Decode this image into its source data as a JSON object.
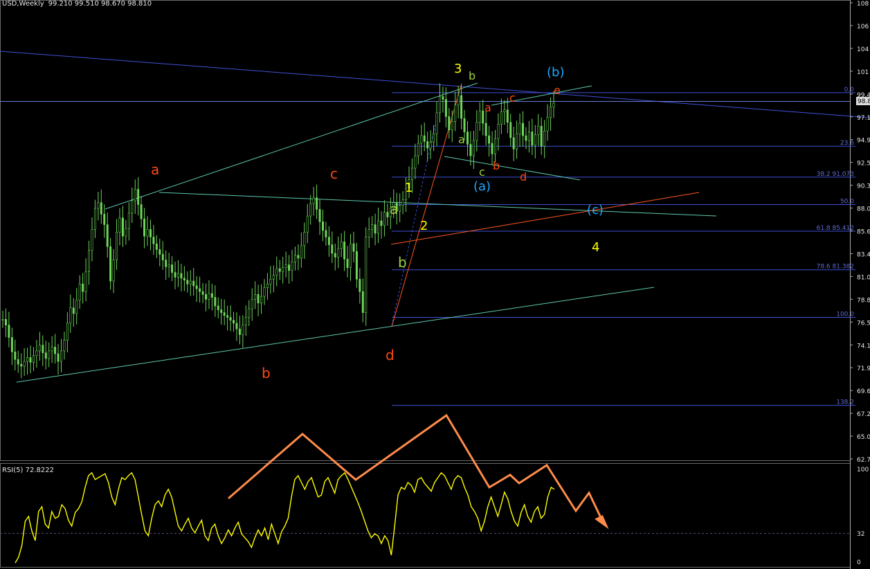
{
  "header": {
    "symbol_text": "USD,Weekly",
    "ohlc_text": "99.210 99.510 98.670 98.810"
  },
  "rsi_header": "RSI(5) 72.8222",
  "colors": {
    "background": "#000000",
    "candles": "#6fd65a",
    "trend_blue": "#3f51d8",
    "trend_cyan": "#5fc9b0",
    "trend_orange": "#ff5a1f",
    "fib": "#3f51d8",
    "rsi": "#ffff00",
    "path_arrows": "#ff8c4a",
    "current_price_line": "#6b7fd9"
  },
  "chart_data": [
    {
      "type": "candlestick",
      "title": "USD,Weekly",
      "ohlc": {
        "open": 99.21,
        "high": 99.51,
        "low": 98.67,
        "close": 98.81
      },
      "y_ticks": [
        "108",
        "106",
        "104",
        "101",
        "99.4",
        "97.1",
        "94.9",
        "92.5",
        "90.3",
        "88.0",
        "85.6",
        "83.4",
        "81.0",
        "78.8",
        "76.5",
        "74.1",
        "71.9",
        "69.6",
        "67.2",
        "65.0",
        "62.7"
      ],
      "ylim": [
        61.6,
        109.3
      ],
      "current_price": "98.8",
      "grid": false,
      "fib_levels": [
        {
          "label": "0.0",
          "price": 99.9
        },
        {
          "label": "23.6",
          "price": 94.3
        },
        {
          "label": "38.2 91.073",
          "price": 91.07
        },
        {
          "label": "50.0",
          "price": 88.2
        },
        {
          "label": "61.8 85.412",
          "price": 85.41
        },
        {
          "label": "78.6 81.382",
          "price": 81.38
        },
        {
          "label": "100.0",
          "price": 76.4
        },
        {
          "label": "138.2",
          "price": 67.2
        }
      ],
      "closes": [
        76.2,
        75.6,
        74.3,
        72.8,
        72.0,
        71.5,
        71.3,
        71.8,
        72.2,
        71.7,
        72.4,
        72.9,
        73.5,
        72.7,
        72.1,
        72.9,
        73.3,
        72.6,
        71.8,
        72.9,
        74.0,
        75.8,
        77.4,
        76.8,
        78.2,
        79.9,
        79.1,
        81.2,
        83.4,
        85.6,
        87.8,
        88.4,
        87.2,
        86.1,
        83.8,
        80.2,
        82.4,
        85.3,
        86.8,
        84.9,
        85.7,
        87.3,
        88.6,
        89.8,
        88.2,
        86.7,
        84.9,
        85.6,
        84.8,
        84.1,
        83.5,
        83.0,
        82.4,
        81.7,
        81.9,
        81.1,
        80.6,
        81.0,
        80.5,
        80.3,
        79.9,
        80.2,
        79.7,
        79.4,
        79.1,
        78.8,
        78.3,
        78.9,
        78.5,
        77.6,
        77.2,
        76.9,
        76.6,
        76.4,
        76.1,
        75.8,
        75.2,
        74.6,
        75.6,
        76.4,
        77.3,
        78.3,
        78.8,
        77.9,
        78.6,
        79.5,
        79.9,
        80.4,
        80.8,
        81.5,
        81.2,
        81.6,
        81.9,
        81.3,
        82.2,
        82.9,
        82.6,
        83.9,
        85.3,
        87.0,
        88.3,
        88.9,
        87.7,
        86.4,
        85.5,
        84.8,
        84.0,
        83.1,
        82.7,
        83.6,
        84.3,
        82.5,
        81.6,
        84.1,
        83.3,
        80.4,
        79.1,
        76.9,
        84.8,
        85.6,
        86.1,
        85.2,
        86.5,
        86.0,
        87.4,
        86.9,
        87.8,
        88.4,
        87.5,
        88.1,
        88.7,
        89.9,
        90.8,
        92.0,
        93.3,
        94.6,
        95.4,
        94.8,
        94.1,
        94.7,
        95.6,
        97.8,
        99.5,
        99.2,
        97.4,
        96.0,
        96.9,
        98.6,
        99.6,
        97.2,
        95.8,
        94.5,
        93.3,
        94.9,
        96.8,
        98.0,
        96.7,
        95.4,
        94.6,
        93.5,
        95.1,
        96.6,
        97.9,
        98.1,
        96.8,
        95.2,
        94.0,
        95.6,
        96.7,
        95.4,
        94.9,
        95.8,
        94.4,
        95.5,
        96.4,
        94.3,
        95.9,
        97.3,
        98.4,
        98.8
      ],
      "wave_labels": [
        "a",
        "b",
        "c",
        "d",
        "a",
        "b",
        "1",
        "2",
        "3",
        "a",
        "b",
        "c",
        "(a)",
        "a",
        "b",
        "c",
        "d",
        "e",
        "(b)",
        "(c)",
        "4"
      ]
    },
    {
      "type": "line",
      "title": "RSI(5) 72.8222",
      "y_ticks": [
        "100",
        "32",
        "0"
      ],
      "ylim": [
        0,
        100
      ],
      "level": 32,
      "values": [
        2,
        8,
        20,
        45,
        50,
        35,
        25,
        55,
        60,
        42,
        38,
        55,
        48,
        50,
        62,
        58,
        46,
        40,
        54,
        58,
        65,
        80,
        92,
        95,
        88,
        90,
        92,
        94,
        85,
        70,
        62,
        78,
        90,
        88,
        92,
        95,
        88,
        70,
        52,
        35,
        30,
        48,
        62,
        66,
        60,
        72,
        78,
        70,
        55,
        40,
        35,
        42,
        48,
        38,
        33,
        40,
        46,
        30,
        25,
        38,
        42,
        30,
        22,
        28,
        36,
        30,
        38,
        44,
        32,
        28,
        24,
        18,
        28,
        36,
        30,
        38,
        26,
        42,
        32,
        22,
        34,
        40,
        48,
        70,
        88,
        92,
        85,
        78,
        86,
        90,
        80,
        70,
        72,
        86,
        90,
        82,
        74,
        88,
        92,
        95,
        88,
        80,
        72,
        64,
        55,
        45,
        35,
        28,
        32,
        30,
        22,
        30,
        25,
        10,
        40,
        72,
        80,
        78,
        85,
        82,
        75,
        88,
        90,
        84,
        80,
        76,
        85,
        90,
        95,
        92,
        85,
        78,
        88,
        92,
        90,
        80,
        72,
        60,
        55,
        48,
        35,
        45,
        60,
        70,
        60,
        50,
        62,
        75,
        68,
        55,
        45,
        40,
        54,
        62,
        50,
        44,
        55,
        60,
        48,
        52,
        70,
        80,
        78
      ]
    }
  ]
}
